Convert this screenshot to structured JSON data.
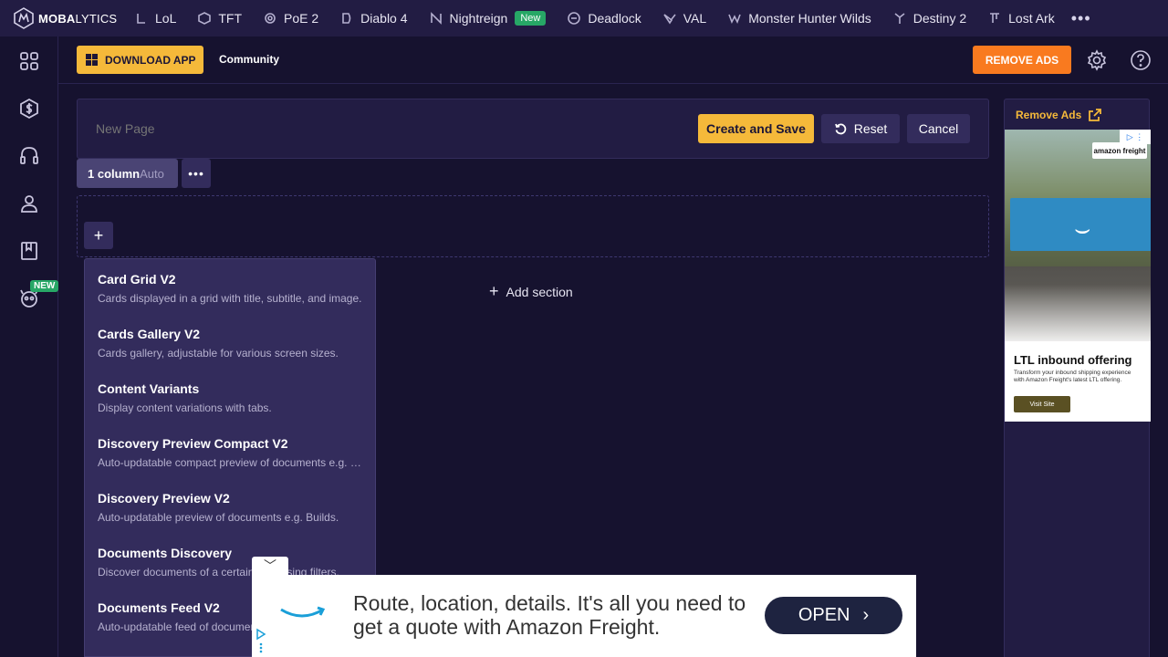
{
  "brand": {
    "logo_bold": "MOBA",
    "logo_thin": "LYTICS"
  },
  "games": [
    {
      "label": "LoL",
      "icon": "lol-icon"
    },
    {
      "label": "TFT",
      "icon": "tft-icon"
    },
    {
      "label": "PoE 2",
      "icon": "poe2-icon"
    },
    {
      "label": "Diablo 4",
      "icon": "diablo4-icon"
    },
    {
      "label": "Nightreign",
      "icon": "nightreign-icon",
      "badge": "New"
    },
    {
      "label": "Deadlock",
      "icon": "deadlock-icon"
    },
    {
      "label": "VAL",
      "icon": "valorant-icon"
    },
    {
      "label": "Monster Hunter Wilds",
      "icon": "mhw-icon"
    },
    {
      "label": "Destiny 2",
      "icon": "destiny2-icon"
    },
    {
      "label": "Lost Ark",
      "icon": "lostark-icon"
    }
  ],
  "rail": {
    "new_badge": "NEW"
  },
  "toolbar": {
    "download_label": "DOWNLOAD APP",
    "community_label": "Community",
    "remove_ads_label": "REMOVE ADS"
  },
  "editor": {
    "page_name_placeholder": "New Page",
    "create_label": "Create and Save",
    "reset_label": "Reset",
    "cancel_label": "Cancel"
  },
  "layout": {
    "columns_label": "1 column",
    "mode_label": "Auto"
  },
  "section": {
    "add_label": "Add section",
    "plus": "+"
  },
  "widgets": [
    {
      "title": "Card Grid V2",
      "desc": "Cards displayed in a grid with title, subtitle, and image."
    },
    {
      "title": "Cards Gallery V2",
      "desc": "Cards gallery, adjustable for various screen sizes."
    },
    {
      "title": "Content Variants",
      "desc": "Display content variations with tabs."
    },
    {
      "title": "Discovery Preview Compact V2",
      "desc": "Auto-updatable compact preview of documents e.g. Builds."
    },
    {
      "title": "Discovery Preview V2",
      "desc": "Auto-updatable preview of documents e.g. Builds."
    },
    {
      "title": "Documents Discovery",
      "desc": "Discover documents of a certain type using filters."
    },
    {
      "title": "Documents Feed V2",
      "desc": "Auto-updatable feed of documents."
    }
  ],
  "side_ad": {
    "remove_label": "Remove Ads",
    "badge": "amazon freight",
    "headline": "LTL inbound offering",
    "body": "Transform your inbound shipping experience with Amazon Freight's latest LTL offering.",
    "cta": "Visit Site"
  },
  "bottom_ad": {
    "copy": "Route, location, details. It's all you need to get a quote with Amazon Freight.",
    "cta": "OPEN"
  }
}
